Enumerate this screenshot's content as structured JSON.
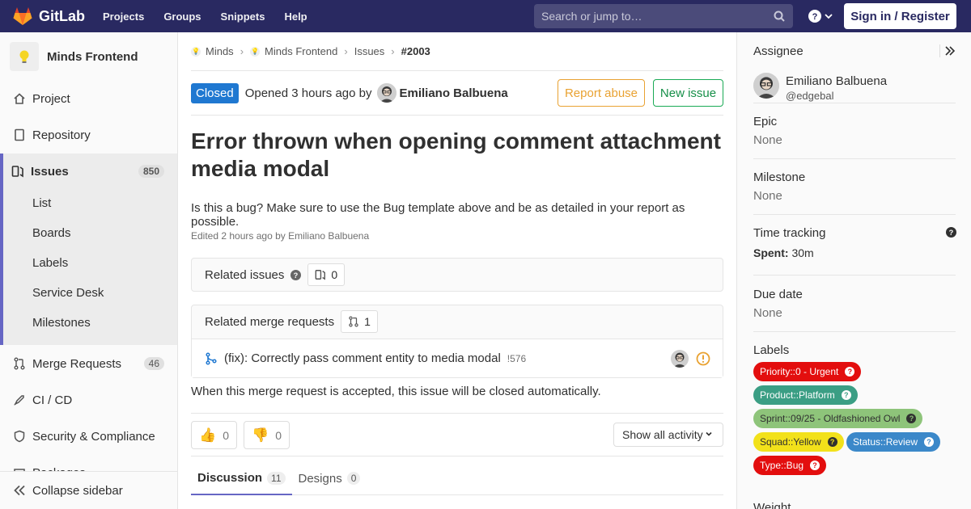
{
  "topbar": {
    "brand": "GitLab",
    "nav": [
      "Projects",
      "Groups",
      "Snippets",
      "Help"
    ],
    "search_placeholder": "Search or jump to…",
    "signin_label": "Sign in / Register",
    "colors": {
      "bar": "#292961"
    }
  },
  "sidebar": {
    "project_name": "Minds Frontend",
    "items": [
      {
        "label": "Project",
        "icon": "home-icon"
      },
      {
        "label": "Repository",
        "icon": "doc-icon"
      },
      {
        "label": "Issues",
        "icon": "issues-icon",
        "count": "850"
      },
      {
        "label": "Merge Requests",
        "icon": "merge-request-icon",
        "count": "46"
      },
      {
        "label": "CI / CD",
        "icon": "rocket-icon"
      },
      {
        "label": "Security & Compliance",
        "icon": "shield-icon"
      },
      {
        "label": "Packages",
        "icon": "package-icon"
      }
    ],
    "issues_sub": [
      "List",
      "Boards",
      "Labels",
      "Service Desk",
      "Milestones"
    ],
    "collapse_label": "Collapse sidebar"
  },
  "breadcrumb": [
    "Minds",
    "Minds Frontend",
    "Issues",
    "#2003"
  ],
  "issue": {
    "status": "Closed",
    "opened_text": "Opened 3 hours ago by",
    "author": "Emiliano Balbuena",
    "report_abuse": "Report abuse",
    "new_issue": "New issue",
    "title": "Error thrown when opening comment attachment media modal",
    "description": "Is this a bug? Make sure to use the Bug template above and be as detailed in your report as possible.",
    "edited": "Edited 2 hours ago by Emiliano Balbuena"
  },
  "related_issues": {
    "label": "Related issues",
    "count": "0"
  },
  "related_mrs": {
    "label": "Related merge requests",
    "count": "1",
    "item_title": "(fix): Correctly pass comment entity to media modal",
    "item_ref": "!576"
  },
  "auto_close_text": "When this merge request is accepted, this issue will be closed automatically.",
  "awards": {
    "thumbs_up": "0",
    "thumbs_down": "0"
  },
  "activity_filter": "Show all activity",
  "tabs": [
    {
      "label": "Discussion",
      "count": "11"
    },
    {
      "label": "Designs",
      "count": "0"
    }
  ],
  "right_sidebar": {
    "assignee_label": "Assignee",
    "assignee_name": "Emiliano Balbuena",
    "assignee_user": "@edgebal",
    "epic_label": "Epic",
    "epic_value": "None",
    "milestone_label": "Milestone",
    "milestone_value": "None",
    "time_label": "Time tracking",
    "spent_label": "Spent:",
    "spent_value": "30m",
    "due_label": "Due date",
    "due_value": "None",
    "labels_label": "Labels",
    "labels": [
      {
        "text": "Priority::0 - Urgent",
        "color": "#e30e0e"
      },
      {
        "text": "Product::Platform",
        "color": "#3b9e84"
      },
      {
        "text": "Sprint::09/25 - Oldfashioned Owl",
        "color": "#8ec47a"
      },
      {
        "text": "Squad::Yellow",
        "color": "#f2e11a"
      },
      {
        "text": "Status::Review",
        "color": "#3b88c9"
      },
      {
        "text": "Type::Bug",
        "color": "#e30e0e"
      }
    ],
    "weight_label": "Weight"
  }
}
